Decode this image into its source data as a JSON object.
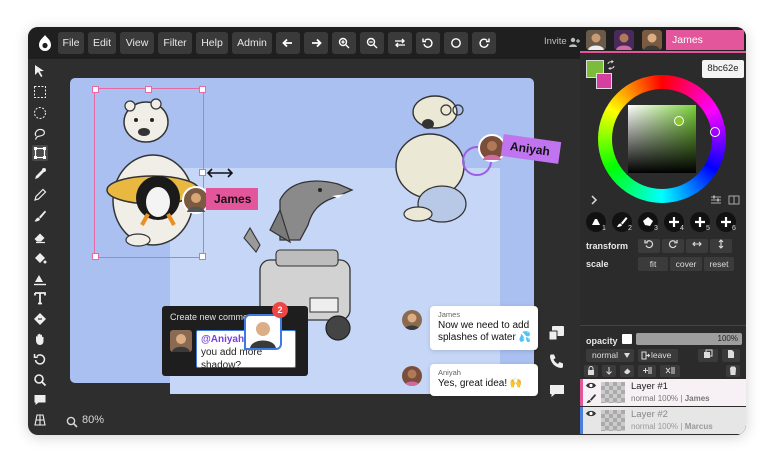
{
  "menu": [
    "File",
    "Edit",
    "View",
    "Filter",
    "Help",
    "Admin"
  ],
  "invite": "Invite",
  "current_user": "James",
  "colors": {
    "accent": "#e4569b",
    "primary": "#7bbd3a",
    "secondary": "#d53fa0",
    "hex": "8bc62e",
    "canvas": "#a9c0f0",
    "aniyah_tag": "#c174f0",
    "james_tag": "#e4569b"
  },
  "brushes": [
    "1",
    "2",
    "3",
    "4",
    "5",
    "6"
  ],
  "transform": {
    "label": "transform"
  },
  "scale": {
    "label": "scale",
    "options": [
      "fit",
      "cover",
      "reset"
    ]
  },
  "opacity": {
    "label": "opacity",
    "value": "100%"
  },
  "blend": {
    "mode": "normal",
    "leave_label": "leave"
  },
  "layers": [
    {
      "name": "Layer #1",
      "mode": "normal",
      "opacity": "100%",
      "owner": "James"
    },
    {
      "name": "Layer #2",
      "mode": "normal",
      "opacity": "100%",
      "owner": "Marcus"
    }
  ],
  "canvas": {
    "tag_james": "James",
    "tag_aniyah": "Aniyah",
    "badge": "2",
    "zoom": "80%"
  },
  "comment": {
    "title": "Create new comment",
    "mention": "@Aniyah",
    "text": " Could you add more shadow?"
  },
  "chat": [
    {
      "name": "James",
      "text": "Now we need to add splashes of water 💦"
    },
    {
      "name": "Aniyah",
      "text": "Yes, great idea! 🙌"
    }
  ]
}
